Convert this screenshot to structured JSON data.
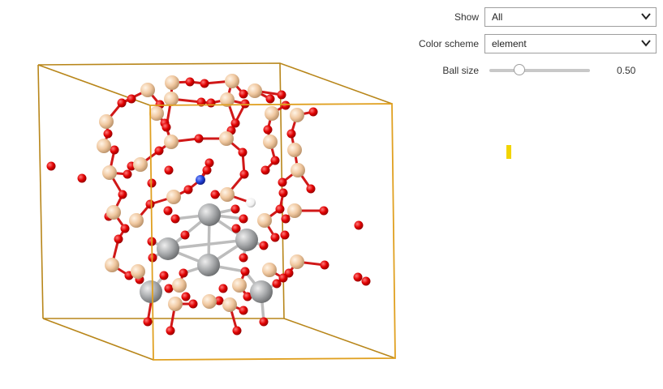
{
  "controls": {
    "show": {
      "label": "Show",
      "value": "All"
    },
    "color_scheme": {
      "label": "Color scheme",
      "value": "element"
    },
    "ball_size": {
      "label": "Ball size",
      "value": "0.50",
      "fraction": 0.3
    }
  },
  "colors": {
    "cell_edge": "#e0a020",
    "cell_edge_dark": "#b8861a",
    "oxygen": "#e00000",
    "silicon": "#f0c8a0",
    "metal": "#a8aaac",
    "nitrogen": "#2040d8",
    "hydrogen": "#ffffff",
    "marker": "#f2d400"
  }
}
